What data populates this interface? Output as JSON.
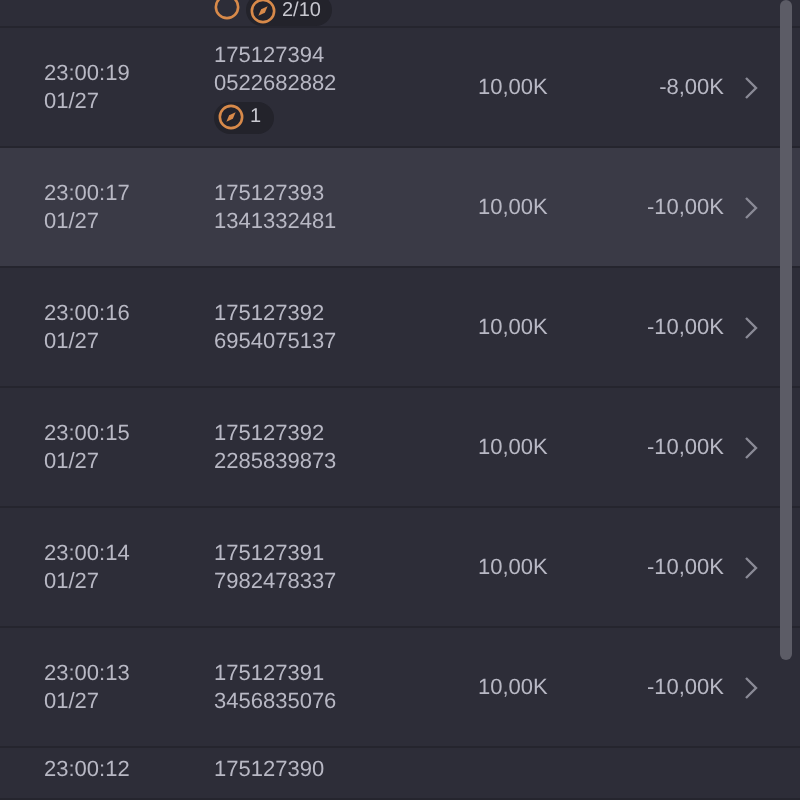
{
  "rows": [
    {
      "kind": "top",
      "badges": [
        {
          "kind": "ring"
        },
        {
          "kind": "compass",
          "text": "2/10"
        }
      ],
      "highlighted": false
    },
    {
      "time": "23:00:19",
      "date": "01/27",
      "id": "175127394",
      "code": "0522682882",
      "amount": "10,00K",
      "change": "-8,00K",
      "badges": [
        {
          "kind": "compass",
          "text": "1"
        }
      ],
      "highlighted": false
    },
    {
      "time": "23:00:17",
      "date": "01/27",
      "id": "175127393",
      "code": "1341332481",
      "amount": "10,00K",
      "change": "-10,00K",
      "highlighted": true
    },
    {
      "time": "23:00:16",
      "date": "01/27",
      "id": "175127392",
      "code": "6954075137",
      "amount": "10,00K",
      "change": "-10,00K",
      "highlighted": false
    },
    {
      "time": "23:00:15",
      "date": "01/27",
      "id": "175127392",
      "code": "2285839873",
      "amount": "10,00K",
      "change": "-10,00K",
      "highlighted": false
    },
    {
      "time": "23:00:14",
      "date": "01/27",
      "id": "175127391",
      "code": "7982478337",
      "amount": "10,00K",
      "change": "-10,00K",
      "highlighted": false
    },
    {
      "time": "23:00:13",
      "date": "01/27",
      "id": "175127391",
      "code": "3456835076",
      "amount": "10,00K",
      "change": "-10,00K",
      "highlighted": false
    },
    {
      "kind": "bottom",
      "time": "23:00:12",
      "id": "175127390",
      "highlighted": false
    }
  ]
}
